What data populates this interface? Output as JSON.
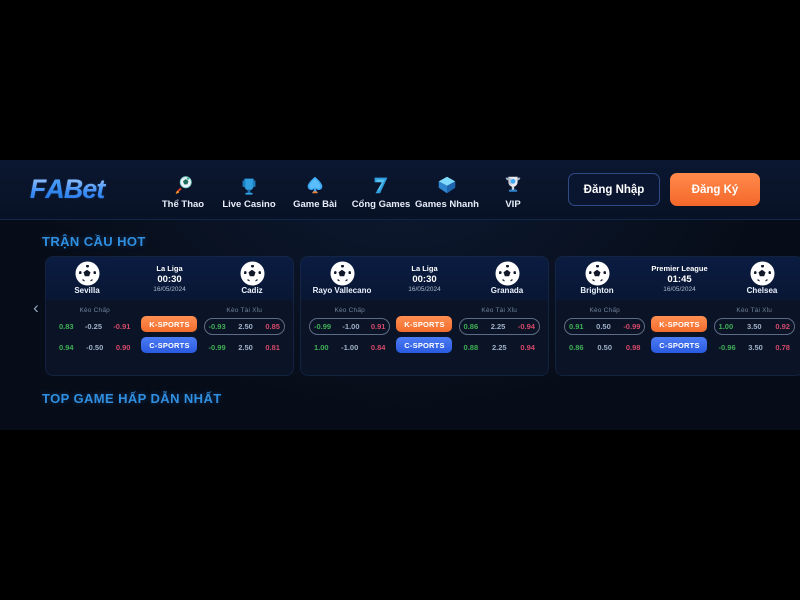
{
  "header": {
    "logo_text_a": "F",
    "logo_text_b": "A",
    "logo_text_c": "Bet",
    "nav": [
      {
        "label": "Thể Thao",
        "icon": "rocket-ball-icon"
      },
      {
        "label": "Live Casino",
        "icon": "casino-chair-icon"
      },
      {
        "label": "Game Bài",
        "icon": "spade-card-icon"
      },
      {
        "label": "Cổng Games",
        "icon": "lucky-seven-icon"
      },
      {
        "label": "Games Nhanh",
        "icon": "gem-box-icon"
      },
      {
        "label": "VIP",
        "icon": "trophy-icon"
      }
    ],
    "login_label": "Đăng Nhập",
    "register_label": "Đăng Ký"
  },
  "sections": {
    "hot_matches_title": "TRẬN CẦU HOT",
    "top_games_title": "TOP GAME HẤP DẪN NHẤT"
  },
  "carousel": {
    "prev_arrow": "‹"
  },
  "odds_labels": {
    "handicap": "Kèo Chấp",
    "over_under": "Kèo Tài Xỉu",
    "k_sports": "K-SPORTS",
    "c_sports": "C-SPORTS"
  },
  "matches": [
    {
      "league": "La Liga",
      "time": "00:30",
      "date": "16/05/2024",
      "home_team": "Sevilla",
      "away_team": "Cadiz",
      "handicap": [
        {
          "highlighted": false,
          "cells": [
            "0.83",
            "-0.25",
            "-0.91"
          ]
        },
        {
          "highlighted": false,
          "cells": [
            "0.94",
            "-0.50",
            "0.90"
          ]
        }
      ],
      "over_under": [
        {
          "highlighted": true,
          "cells": [
            "-0.93",
            "2.50",
            "0.85"
          ]
        },
        {
          "highlighted": false,
          "cells": [
            "-0.99",
            "2.50",
            "0.81"
          ]
        }
      ]
    },
    {
      "league": "La Liga",
      "time": "00:30",
      "date": "16/05/2024",
      "home_team": "Rayo Vallecano",
      "away_team": "Granada",
      "handicap": [
        {
          "highlighted": true,
          "cells": [
            "-0.99",
            "-1.00",
            "0.91"
          ]
        },
        {
          "highlighted": false,
          "cells": [
            "1.00",
            "-1.00",
            "0.84"
          ]
        }
      ],
      "over_under": [
        {
          "highlighted": true,
          "cells": [
            "0.86",
            "2.25",
            "-0.94"
          ]
        },
        {
          "highlighted": false,
          "cells": [
            "0.88",
            "2.25",
            "0.94"
          ]
        }
      ]
    },
    {
      "league": "Premier League",
      "time": "01:45",
      "date": "16/05/2024",
      "home_team": "Brighton",
      "away_team": "Chelsea",
      "handicap": [
        {
          "highlighted": true,
          "cells": [
            "0.91",
            "0.50",
            "-0.99"
          ]
        },
        {
          "highlighted": false,
          "cells": [
            "0.86",
            "0.50",
            "0.98"
          ]
        }
      ],
      "over_under": [
        {
          "highlighted": true,
          "cells": [
            "1.00",
            "3.50",
            "0.92"
          ]
        },
        {
          "highlighted": false,
          "cells": [
            "-0.96",
            "3.50",
            "0.78"
          ]
        }
      ]
    }
  ],
  "colors": {
    "accent_blue": "#2f8fe0",
    "orange": "#f4682a",
    "green": "#3fae55",
    "red": "#d4486a"
  }
}
